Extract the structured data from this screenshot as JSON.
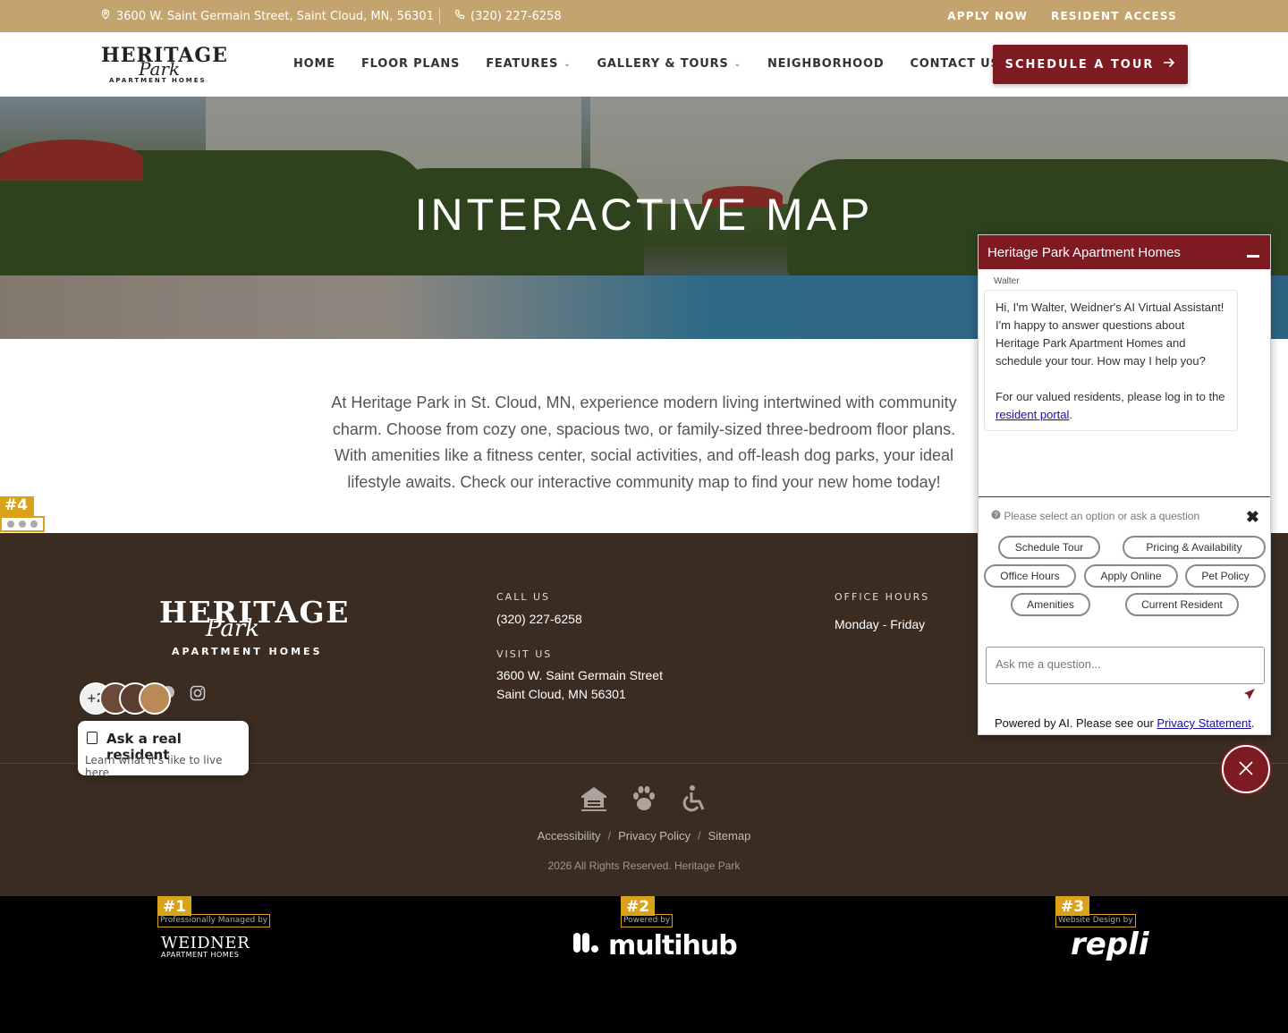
{
  "colors": {
    "gold": "#c4a46e",
    "burgundy": "#7e1a22",
    "footer_bg": "#3a2c20",
    "marker": "#d9a219"
  },
  "topbar": {
    "address": "3600 W. Saint Germain Street, Saint Cloud, MN, 56301",
    "phone": "(320) 227-6258",
    "apply": "APPLY NOW",
    "resident": "RESIDENT ACCESS"
  },
  "logo": {
    "line1": "HERITAGE",
    "line2": "Park",
    "line3": "APARTMENT HOMES"
  },
  "nav": {
    "home": "HOME",
    "floor_plans": "FLOOR PLANS",
    "features": "FEATURES",
    "gallery": "GALLERY & TOURS",
    "neighborhood": "NEIGHBORHOOD",
    "contact": "CONTACT US"
  },
  "cta": {
    "schedule": "SCHEDULE A TOUR"
  },
  "hero": {
    "title": "INTERACTIVE MAP"
  },
  "intro": {
    "text": "At Heritage Park in St. Cloud, MN, experience modern living intertwined with community charm. Choose from cozy one, spacious two, or family-sized three-bedroom floor plans. With amenities like a fitness center, social activities, and off-leash dog parks, your ideal lifestyle awaits. Check our interactive community map to find your new home today!"
  },
  "markers": {
    "m1": "#1",
    "m2": "#2",
    "m3": "#3",
    "m4": "#4"
  },
  "footer": {
    "call_head": "CALL US",
    "phone": "(320) 227-6258",
    "visit_head": "VISIT US",
    "street": "3600 W. Saint Germain Street",
    "city": "Saint Cloud, MN 56301",
    "hours_head": "OFFICE HOURS",
    "hours": "Monday - Friday",
    "links": {
      "accessibility": "Accessibility",
      "privacy": "Privacy Policy",
      "sitemap": "Sitemap",
      "sep": "/"
    },
    "copyright": "2026 All Rights Reserved. Heritage Park"
  },
  "ask_widget": {
    "count": "+2",
    "title": "Ask a real resident",
    "subtitle": "Learn what it's like to live here"
  },
  "bottom": {
    "managed": "Professionally Managed by",
    "powered": "Powered by",
    "design": "Website Design by",
    "weidner_1": "WEIDNER",
    "weidner_2": "APARTMENT HOMES",
    "multihub": "multihub",
    "repli": "repli"
  },
  "chat": {
    "title": "Heritage Park Apartment Homes",
    "agent": "Walter",
    "message": "Hi, I'm Walter, Weidner's AI Virtual Assistant! I'm happy to answer questions about Heritage Park Apartment Homes and schedule your tour. How may I help you?",
    "message2": "For our valued residents, please log in to the",
    "portal_link": "resident portal",
    "prompt": "Please select an option or ask a question",
    "chips": {
      "schedule": "Schedule Tour",
      "pricing": "Pricing & Availability",
      "office": "Office Hours",
      "apply": "Apply Online",
      "pet": "Pet Policy",
      "amenities": "Amenities",
      "current": "Current Resident"
    },
    "input_placeholder": "Ask me a question...",
    "powered": "Powered by AI. Please see our",
    "privacy": "Privacy Statement"
  }
}
